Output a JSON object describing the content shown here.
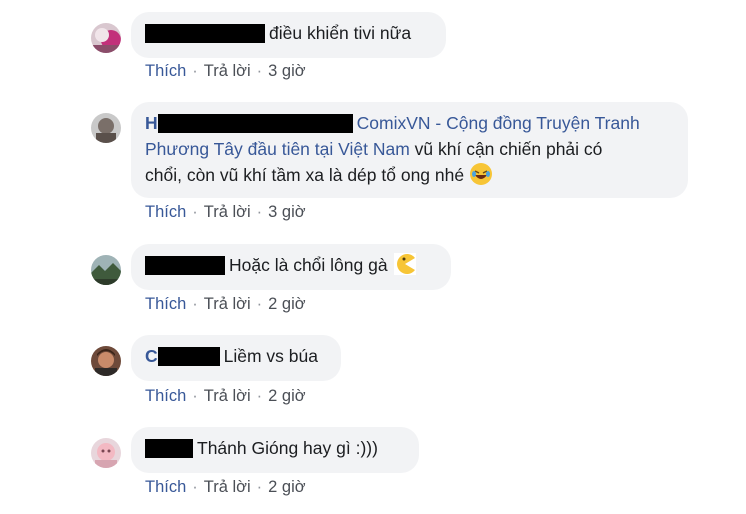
{
  "comments": [
    {
      "name_visible": "",
      "text": "điều khiển tivi nữa",
      "actions": {
        "like": "Thích",
        "reply": "Trả lời",
        "time": "3 giờ"
      }
    },
    {
      "name_visible": "H",
      "mention": "ComixVN - Cộng đồng Truyện Tranh",
      "mention_line2": "Phương Tây đầu tiên tại Việt Nam",
      "text_after_mention": " vũ khí cận chiến phải có",
      "text_line3": "chổi, còn vũ khí tầm xa là dép tổ ong nhé",
      "emoji": "laughing-emoji",
      "actions": {
        "like": "Thích",
        "reply": "Trả lời",
        "time": "3 giờ"
      }
    },
    {
      "name_visible": "",
      "text": "Hoặc là chổi lông gà",
      "emoji": "pacman-emoji",
      "actions": {
        "like": "Thích",
        "reply": "Trả lời",
        "time": "2 giờ"
      }
    },
    {
      "name_visible": "C",
      "text": "Liềm vs búa",
      "actions": {
        "like": "Thích",
        "reply": "Trả lời",
        "time": "2 giờ"
      }
    },
    {
      "name_visible": "",
      "text": "Thánh Gióng hay gì :)))",
      "actions": {
        "like": "Thích",
        "reply": "Trả lời",
        "time": "2 giờ"
      }
    }
  ],
  "colors": {
    "bubble_bg": "#f2f3f5",
    "link": "#385898",
    "action_text": "#4b4f56",
    "redaction": "#000000"
  }
}
